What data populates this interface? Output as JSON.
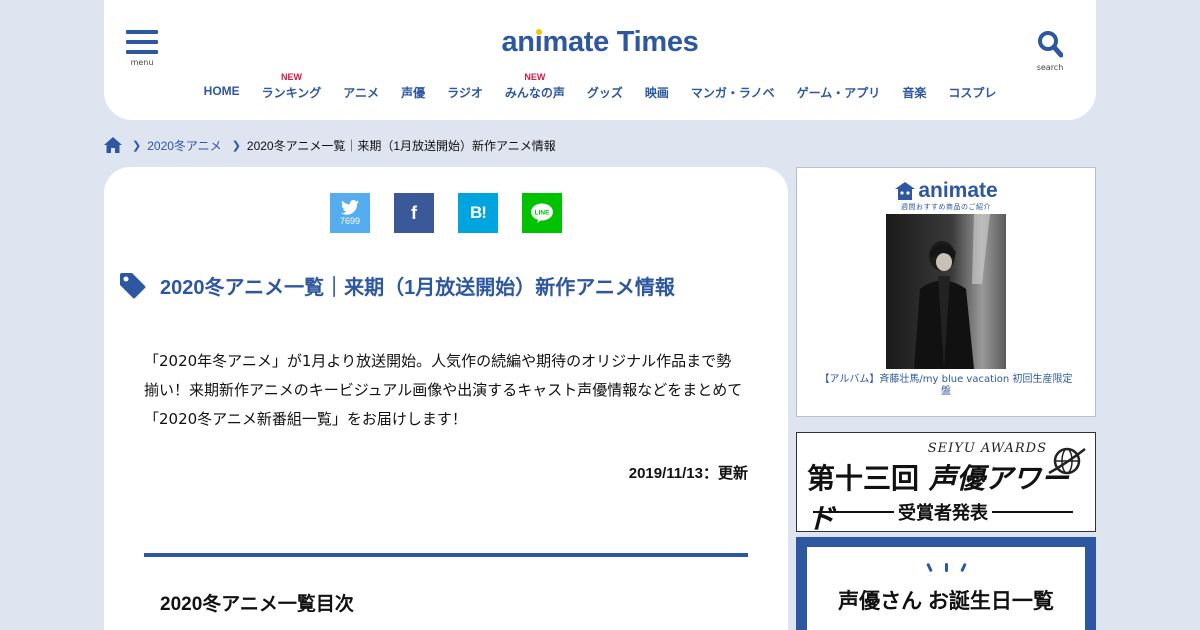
{
  "header": {
    "menu_caption": "menu",
    "search_caption": "search",
    "logo": {
      "part1": "an",
      "part2": "i",
      "part3": "mate Times"
    },
    "nav": [
      {
        "label": "HOME",
        "badge": ""
      },
      {
        "label": "ランキング",
        "badge": "NEW"
      },
      {
        "label": "アニメ",
        "badge": ""
      },
      {
        "label": "声優",
        "badge": ""
      },
      {
        "label": "ラジオ",
        "badge": ""
      },
      {
        "label": "みんなの声",
        "badge": "NEW"
      },
      {
        "label": "グッズ",
        "badge": ""
      },
      {
        "label": "映画",
        "badge": ""
      },
      {
        "label": "マンガ・ラノベ",
        "badge": ""
      },
      {
        "label": "ゲーム・アプリ",
        "badge": ""
      },
      {
        "label": "音楽",
        "badge": ""
      },
      {
        "label": "コスプレ",
        "badge": ""
      }
    ]
  },
  "breadcrumb": {
    "items": [
      "2020冬アニメ",
      "2020冬アニメ一覧｜来期（1月放送開始）新作アニメ情報"
    ]
  },
  "share": {
    "twitter_count": "7699",
    "facebook_label": "f",
    "hatena_label": "B!",
    "line_label": "LINE"
  },
  "article": {
    "title": "2020冬アニメ一覧｜来期（1月放送開始）新作アニメ情報",
    "lead": "「2020年冬アニメ」が1月より放送開始。人気作の続編や期待のオリジナル作品まで勢揃い！来期新作アニメのキービジュアル画像や出演するキャスト声優情報などをまとめて「2020冬アニメ新番組一覧」をお届けします！",
    "updated": "2019/11/13：更新",
    "toc_title": "2020冬アニメ一覧目次"
  },
  "sidebar": {
    "ad": {
      "logo_text": "animate",
      "subtitle": "週間おすすめ商品のご紹介",
      "caption": "【アルバム】斉藤壮馬/my blue vacation 初回生産限定盤"
    },
    "banner1": {
      "top": "SEIYU AWARDS",
      "main_a": "第十三回",
      "main_b": "声優アワード",
      "bottom": "受賞者発表"
    },
    "banner2": {
      "text": "声優さん お誕生日一覧"
    }
  },
  "colors": {
    "brand": "#2d57a0",
    "accent_new": "#d41a45",
    "background": "#dfe4f1"
  }
}
